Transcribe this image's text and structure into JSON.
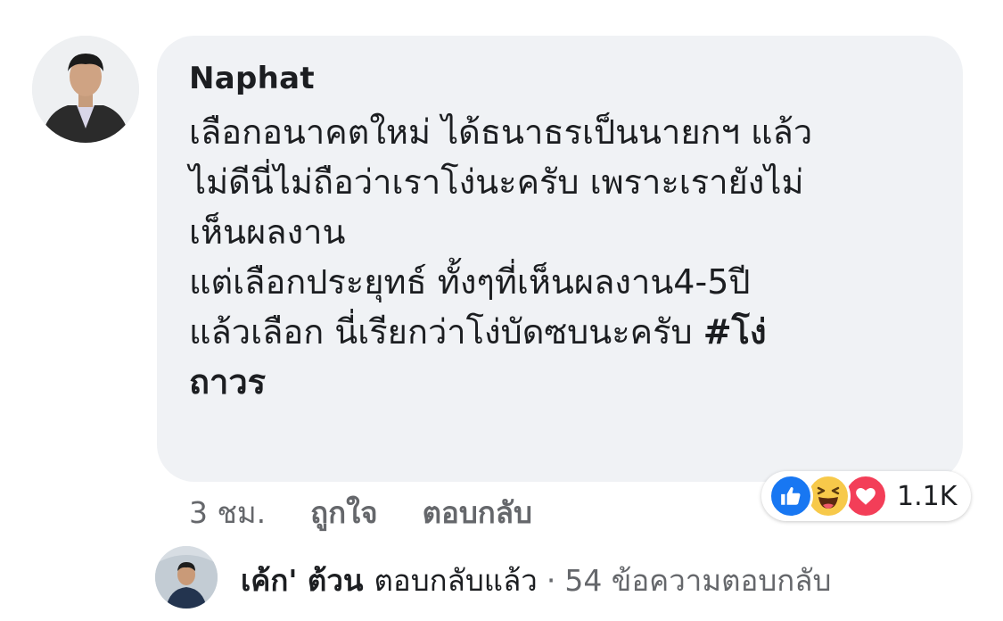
{
  "comment": {
    "author": "Naphat",
    "lines": [
      "เลือกอนาคตใหม่ ได้ธนาธรเป็นนายกฯ แล้ว",
      "ไม่ดีนี่ไม่ถือว่าเราโง่นะครับ เพราะเรายังไม่",
      "เห็นผลงาน",
      "แต่เลือกประยุทธ์ ทั้งๆที่เห็นผลงาน4-5ปี",
      "แล้วเลือก นี่เรียกว่าโง่บัดซบนะครับ ",
      "ถาวร"
    ],
    "hashtag_start": "#โง่"
  },
  "reactions": {
    "icons": [
      "like-icon",
      "haha-icon",
      "love-icon"
    ],
    "count": "1.1K",
    "colors": {
      "like": "#1877f2",
      "haha": "#f7c94a",
      "love": "#f33e58"
    }
  },
  "actions": {
    "time": "3 ชม.",
    "like_label": "ถูกใจ",
    "reply_label": "ตอบกลับ"
  },
  "reply_summary": {
    "name": "เค้ก' ต้วน",
    "action": "ตอบกลับแล้ว",
    "separator": "·",
    "count_text": "54 ข้อความตอบกลับ"
  }
}
